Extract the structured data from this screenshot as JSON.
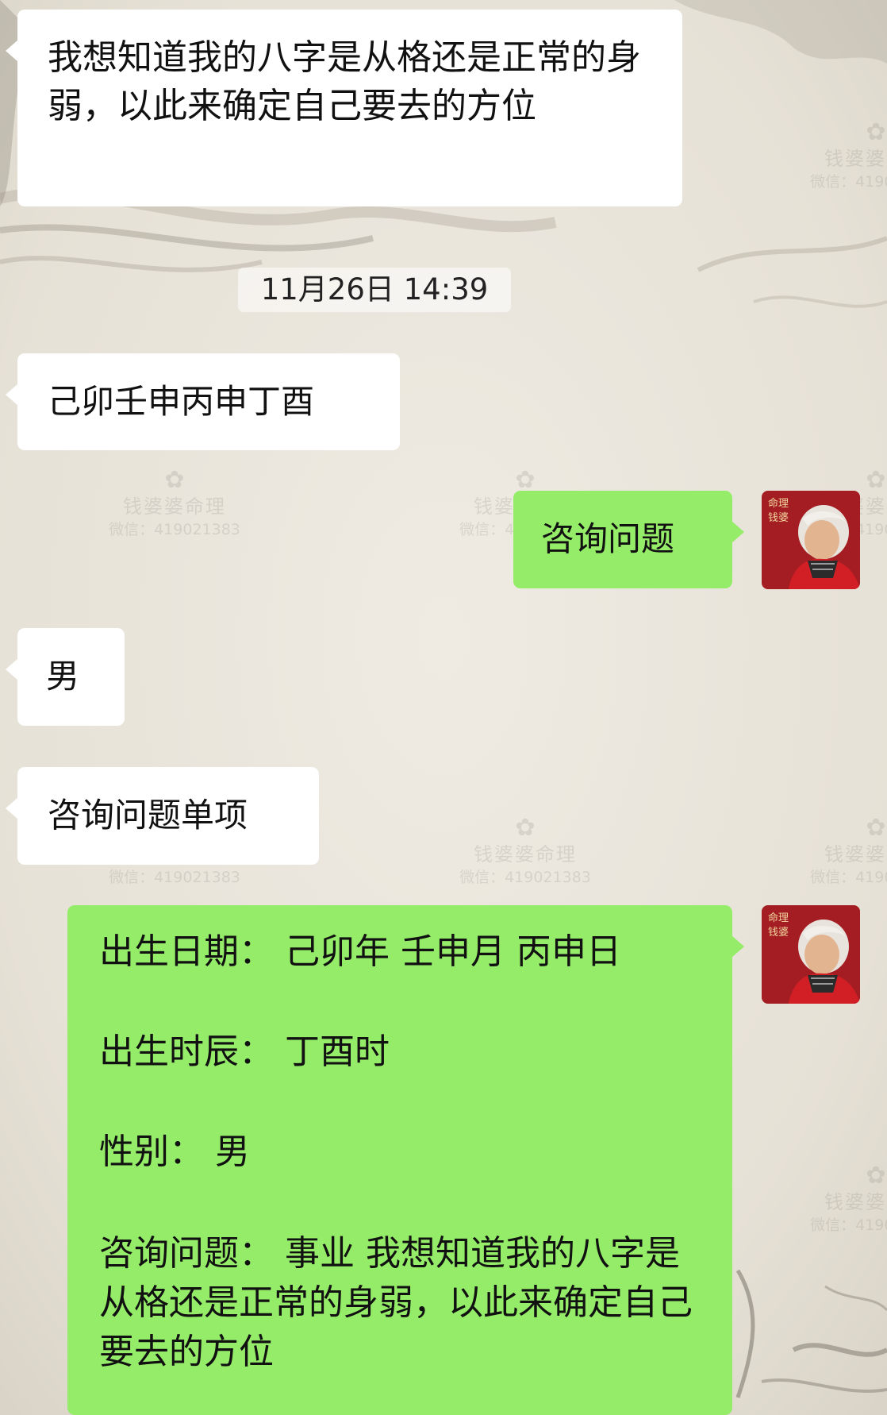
{
  "watermark": {
    "name": "钱婆婆命理",
    "wechat": "微信：419021383"
  },
  "messages": [
    {
      "side": "left",
      "text": "我想知道我的八字是从格还是正常的身弱，以此来确定自己要去的方位"
    },
    {
      "type": "timestamp",
      "text": "11月26日 14:39"
    },
    {
      "side": "left",
      "text": "己卯壬申丙申丁酉"
    },
    {
      "side": "right",
      "text": "咨询问题"
    },
    {
      "side": "left",
      "text": "男"
    },
    {
      "side": "left",
      "text": "咨询问题单项"
    },
    {
      "side": "right",
      "fields": [
        "出生日期： 己卯年 壬申月 丙申日",
        "出生时辰： 丁酉时",
        "性别： 男",
        "咨询问题： 事业 我想知道我的八字是从格还是正常的身弱，以此来确定自己要去的方位"
      ]
    }
  ],
  "colors": {
    "sent_bubble": "#95ec69",
    "received_bubble": "#ffffff",
    "background": "#e9e4da",
    "avatar_bg": "#b8232a"
  },
  "avatar": {
    "icon": "elderly-woman-avatar",
    "seal_text": "命理钱婆"
  }
}
